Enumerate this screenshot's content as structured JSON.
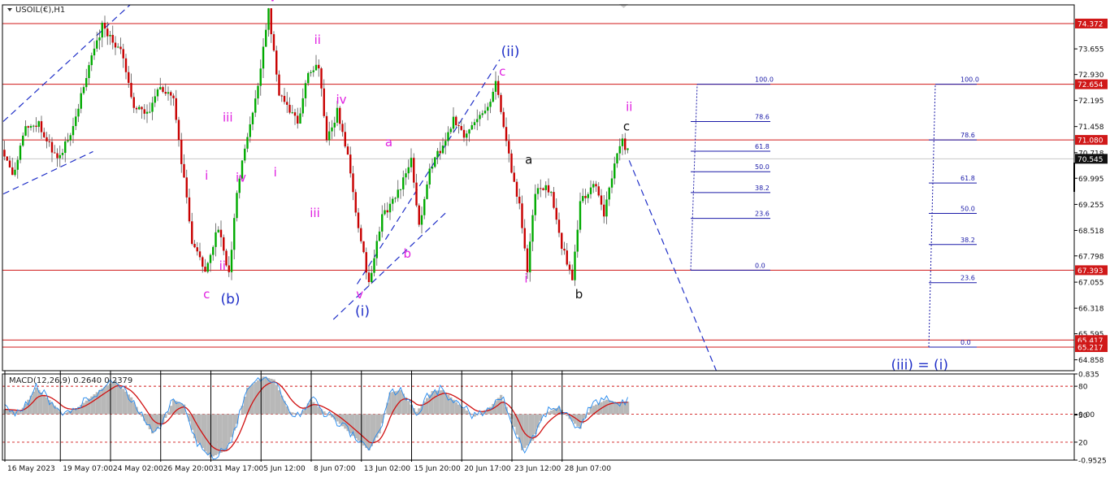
{
  "colors": {
    "background": "#ffffff",
    "grid": "#c0c0c0",
    "hline": "#d01818",
    "bull": "#00aa00",
    "bear": "#c80000",
    "wick": "#555555",
    "wave_magenta": "#e020e0",
    "wave_blue": "#2030c8",
    "wave_black": "#111111",
    "fib": "#1a1aa8",
    "macd_hist": "#b8b8b8",
    "macd_signal": "#d01010",
    "macd_line": "#2288ee",
    "price_tag": "#d01818",
    "current_tag": "#111111"
  },
  "chart_data": [
    {
      "type": "candlestick",
      "title": "USOIL(€),H1",
      "ylim": [
        64.55,
        74.9
      ],
      "grid": true,
      "x_tick_labels": [
        "16 May 2023",
        "19 May 07:00",
        "24 May 02:00",
        "26 May 20:00",
        "31 May 17:00",
        "5 Jun 12:00",
        "8 Jun 07:00",
        "13 Jun 02:00",
        "15 Jun 20:00",
        "20 Jun 17:00",
        "23 Jun 12:00",
        "28 Jun 07:00"
      ],
      "y_tick_labels": [
        "74.372",
        "73.655",
        "72.930",
        "72.654",
        "72.195",
        "71.458",
        "71.080",
        "70.718",
        "70.545",
        "69.995",
        "69.255",
        "68.518",
        "67.798",
        "67.393",
        "67.055",
        "66.318",
        "65.595",
        "65.417",
        "65.217",
        "64.858"
      ],
      "current_price": 70.545,
      "anchors": [
        [
          0,
          70.8
        ],
        [
          4,
          70.0
        ],
        [
          9,
          71.5
        ],
        [
          14,
          71.5
        ],
        [
          21,
          70.5
        ],
        [
          27,
          71.4
        ],
        [
          33,
          73.2
        ],
        [
          38,
          74.3
        ],
        [
          45,
          73.6
        ],
        [
          50,
          72.0
        ],
        [
          55,
          71.8
        ],
        [
          60,
          72.6
        ],
        [
          65,
          72.2
        ],
        [
          72,
          68.2
        ],
        [
          77,
          67.4
        ],
        [
          82,
          68.6
        ],
        [
          86,
          67.3
        ],
        [
          89,
          69.6
        ],
        [
          93,
          71.2
        ],
        [
          97,
          72.6
        ],
        [
          101,
          74.7
        ],
        [
          105,
          72.4
        ],
        [
          112,
          71.6
        ],
        [
          116,
          72.9
        ],
        [
          120,
          73.2
        ],
        [
          123,
          71.0
        ],
        [
          127,
          71.9
        ],
        [
          131,
          70.6
        ],
        [
          135,
          68.6
        ],
        [
          139,
          67.0
        ],
        [
          144,
          68.9
        ],
        [
          150,
          69.6
        ],
        [
          155,
          70.5
        ],
        [
          158,
          68.6
        ],
        [
          162,
          70.3
        ],
        [
          167,
          70.9
        ],
        [
          171,
          71.7
        ],
        [
          175,
          71.2
        ],
        [
          180,
          71.6
        ],
        [
          184,
          72.0
        ],
        [
          187,
          72.7
        ],
        [
          192,
          70.6
        ],
        [
          196,
          69.2
        ],
        [
          199,
          67.4
        ],
        [
          202,
          69.6
        ],
        [
          206,
          69.7
        ],
        [
          208,
          69.5
        ],
        [
          212,
          68.1
        ],
        [
          216,
          67.1
        ],
        [
          219,
          69.4
        ],
        [
          225,
          69.8
        ],
        [
          228,
          69.0
        ],
        [
          232,
          70.4
        ],
        [
          235,
          71.2
        ],
        [
          236,
          70.9
        ]
      ],
      "horizontal_levels": [
        74.372,
        72.654,
        71.08,
        67.393,
        65.417,
        65.217
      ],
      "horizontal_level_labels": [
        "74.372",
        "72.654",
        "71.080",
        "67.393",
        "65.417",
        "65.217"
      ],
      "fib_retracement_1": [
        {
          "label": "100.0",
          "price": 72.654
        },
        {
          "label": "78.6",
          "price": 71.6
        },
        {
          "label": "61.8",
          "price": 70.76
        },
        {
          "label": "50.0",
          "price": 70.18
        },
        {
          "label": "38.2",
          "price": 69.59
        },
        {
          "label": "23.6",
          "price": 68.86
        },
        {
          "label": "0.0",
          "price": 67.393
        }
      ],
      "fib_retracement_2": [
        {
          "label": "100.0",
          "price": 72.654
        },
        {
          "label": "78.6",
          "price": 71.08
        },
        {
          "label": "61.8",
          "price": 69.86
        },
        {
          "label": "50.0",
          "price": 69.0
        },
        {
          "label": "38.2",
          "price": 68.12
        },
        {
          "label": "23.6",
          "price": 67.04
        },
        {
          "label": "0.0",
          "price": 65.217
        }
      ],
      "wave_labels": [
        {
          "text": "i",
          "color": "magenta",
          "bar": 77,
          "price": 69.95
        },
        {
          "text": "ii",
          "color": "magenta",
          "bar": 83,
          "price": 67.4
        },
        {
          "text": "c",
          "color": "magenta",
          "bar": 77,
          "price": 66.6
        },
        {
          "text": "(b)",
          "color": "blue",
          "bar": 86,
          "price": 66.45
        },
        {
          "text": "iii",
          "color": "magenta",
          "bar": 85,
          "price": 71.6
        },
        {
          "text": "iv",
          "color": "magenta",
          "bar": 90,
          "price": 69.9
        },
        {
          "text": "v",
          "color": "magenta",
          "bar": 102,
          "price": 75.0
        },
        {
          "text": "i",
          "color": "magenta",
          "bar": 103,
          "price": 70.05
        },
        {
          "text": "ii",
          "color": "magenta",
          "bar": 119,
          "price": 73.8
        },
        {
          "text": "iii",
          "color": "magenta",
          "bar": 118,
          "price": 68.9
        },
        {
          "text": "iv",
          "color": "magenta",
          "bar": 128,
          "price": 72.1
        },
        {
          "text": "v",
          "color": "magenta",
          "bar": 135,
          "price": 66.6
        },
        {
          "text": "(i)",
          "color": "blue",
          "bar": 136,
          "price": 66.1
        },
        {
          "text": "a",
          "color": "magenta",
          "bar": 146,
          "price": 70.9
        },
        {
          "text": "b",
          "color": "magenta",
          "bar": 153,
          "price": 67.75
        },
        {
          "text": "(ii)",
          "color": "blue",
          "bar": 192,
          "price": 73.45
        },
        {
          "text": "c",
          "color": "magenta",
          "bar": 189,
          "price": 72.9
        },
        {
          "text": "a",
          "color": "black",
          "bar": 199,
          "price": 70.4
        },
        {
          "text": "i",
          "color": "magenta",
          "bar": 198,
          "price": 67.05
        },
        {
          "text": "b",
          "color": "black",
          "bar": 218,
          "price": 66.6
        },
        {
          "text": "ii",
          "color": "magenta",
          "bar": 237,
          "price": 71.9
        },
        {
          "text": "c",
          "color": "black",
          "bar": 236,
          "price": 71.35
        },
        {
          "text": "(iii) = (i)",
          "color": "blue",
          "bar": 347,
          "price": 64.58
        }
      ]
    },
    {
      "type": "line",
      "title": "MACD(12,26,9) 0.2640 0.2379",
      "ylim": [
        -0.9525,
        0.835
      ],
      "y_tick_labels": [
        "0.835",
        "80",
        "0.00",
        "50",
        "20",
        "-0.9525"
      ],
      "levels": [
        80,
        50,
        20
      ],
      "series": [
        {
          "name": "MACD",
          "values": "histogram"
        },
        {
          "name": "Signal",
          "values": "line"
        }
      ],
      "anchors": [
        [
          0,
          0.1
        ],
        [
          6,
          0.05
        ],
        [
          12,
          0.55
        ],
        [
          16,
          0.35
        ],
        [
          22,
          0.0
        ],
        [
          28,
          0.15
        ],
        [
          36,
          0.5
        ],
        [
          42,
          0.7
        ],
        [
          48,
          0.35
        ],
        [
          52,
          -0.05
        ],
        [
          56,
          -0.4
        ],
        [
          60,
          -0.2
        ],
        [
          64,
          0.3
        ],
        [
          68,
          0.2
        ],
        [
          72,
          -0.5
        ],
        [
          78,
          -0.9
        ],
        [
          84,
          -0.75
        ],
        [
          88,
          -0.2
        ],
        [
          92,
          0.55
        ],
        [
          98,
          0.78
        ],
        [
          102,
          0.72
        ],
        [
          108,
          0.05
        ],
        [
          112,
          0.0
        ],
        [
          116,
          0.3
        ],
        [
          120,
          0.1
        ],
        [
          126,
          -0.15
        ],
        [
          132,
          -0.45
        ],
        [
          138,
          -0.75
        ],
        [
          142,
          -0.4
        ],
        [
          146,
          0.45
        ],
        [
          150,
          0.5
        ],
        [
          156,
          0.05
        ],
        [
          162,
          0.48
        ],
        [
          166,
          0.5
        ],
        [
          172,
          0.2
        ],
        [
          178,
          -0.05
        ],
        [
          184,
          0.15
        ],
        [
          188,
          0.4
        ],
        [
          192,
          -0.1
        ],
        [
          196,
          -0.75
        ],
        [
          200,
          -0.55
        ],
        [
          204,
          0.0
        ],
        [
          210,
          0.15
        ],
        [
          214,
          -0.1
        ],
        [
          218,
          -0.3
        ],
        [
          222,
          0.15
        ],
        [
          228,
          0.3
        ],
        [
          232,
          0.25
        ],
        [
          236,
          0.26
        ]
      ]
    }
  ]
}
